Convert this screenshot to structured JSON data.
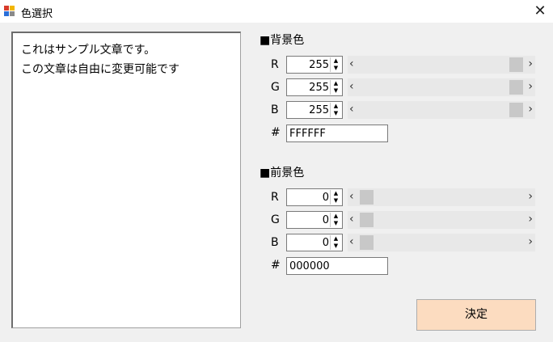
{
  "window": {
    "title": "色選択",
    "close_glyph": "✕"
  },
  "preview": {
    "lines": [
      "これはサンプル文章です。",
      "この文章は自由に変更可能です"
    ]
  },
  "background": {
    "heading": "■背景色",
    "r": {
      "label": "R",
      "value": "255",
      "level": 255
    },
    "g": {
      "label": "G",
      "value": "255",
      "level": 255
    },
    "b": {
      "label": "B",
      "value": "255",
      "level": 255
    },
    "hex_label": "#",
    "hex": "FFFFFF"
  },
  "foreground": {
    "heading": "■前景色",
    "r": {
      "label": "R",
      "value": "0",
      "level": 0
    },
    "g": {
      "label": "G",
      "value": "0",
      "level": 0
    },
    "b": {
      "label": "B",
      "value": "0",
      "level": 0
    },
    "hex_label": "#",
    "hex": "000000"
  },
  "ok_button": "決定",
  "arrows": {
    "left": "‹",
    "right": "›",
    "up": "▲",
    "down": "▼"
  },
  "colors": {
    "button_bg": "#fcdcc0",
    "track": "#e8e8e8",
    "thumb": "#c8c8c8"
  }
}
